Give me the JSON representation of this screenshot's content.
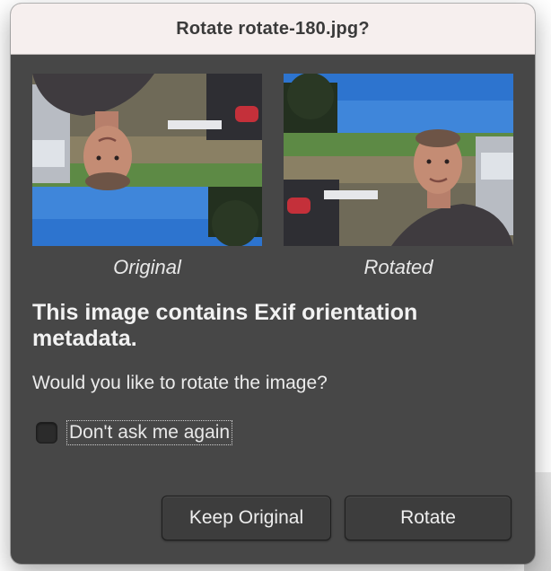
{
  "dialog": {
    "title": "Rotate rotate-180.jpg?",
    "preview": {
      "original_caption": "Original",
      "rotated_caption": "Rotated"
    },
    "heading": "This image contains Exif orientation metadata.",
    "question": "Would you like to rotate the image?",
    "checkbox": {
      "label": "Don't ask me again",
      "checked": false
    },
    "buttons": {
      "keep_label": "Keep Original",
      "rotate_label": "Rotate"
    }
  },
  "colors": {
    "dialog_background": "#474747",
    "titlebar_background": "#f6efee",
    "button_background": "#3d3d3d",
    "text": "#eeeeee"
  }
}
